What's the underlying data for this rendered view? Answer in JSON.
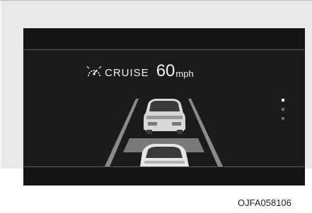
{
  "cluster": {
    "cruise_label": "CRUISE",
    "set_speed": "60",
    "speed_unit": "mph",
    "icon": "cruise-control-icon",
    "page_indicator": {
      "total": 3,
      "active": 1
    }
  },
  "figure_code": "OJFA058106",
  "colors": {
    "display_bg": "#1b1b1b",
    "text": "#f2f2f2",
    "lane_line": "#8a8a8a",
    "gap_bar": "#7a7a7a",
    "frame": "#e9e9e9"
  }
}
